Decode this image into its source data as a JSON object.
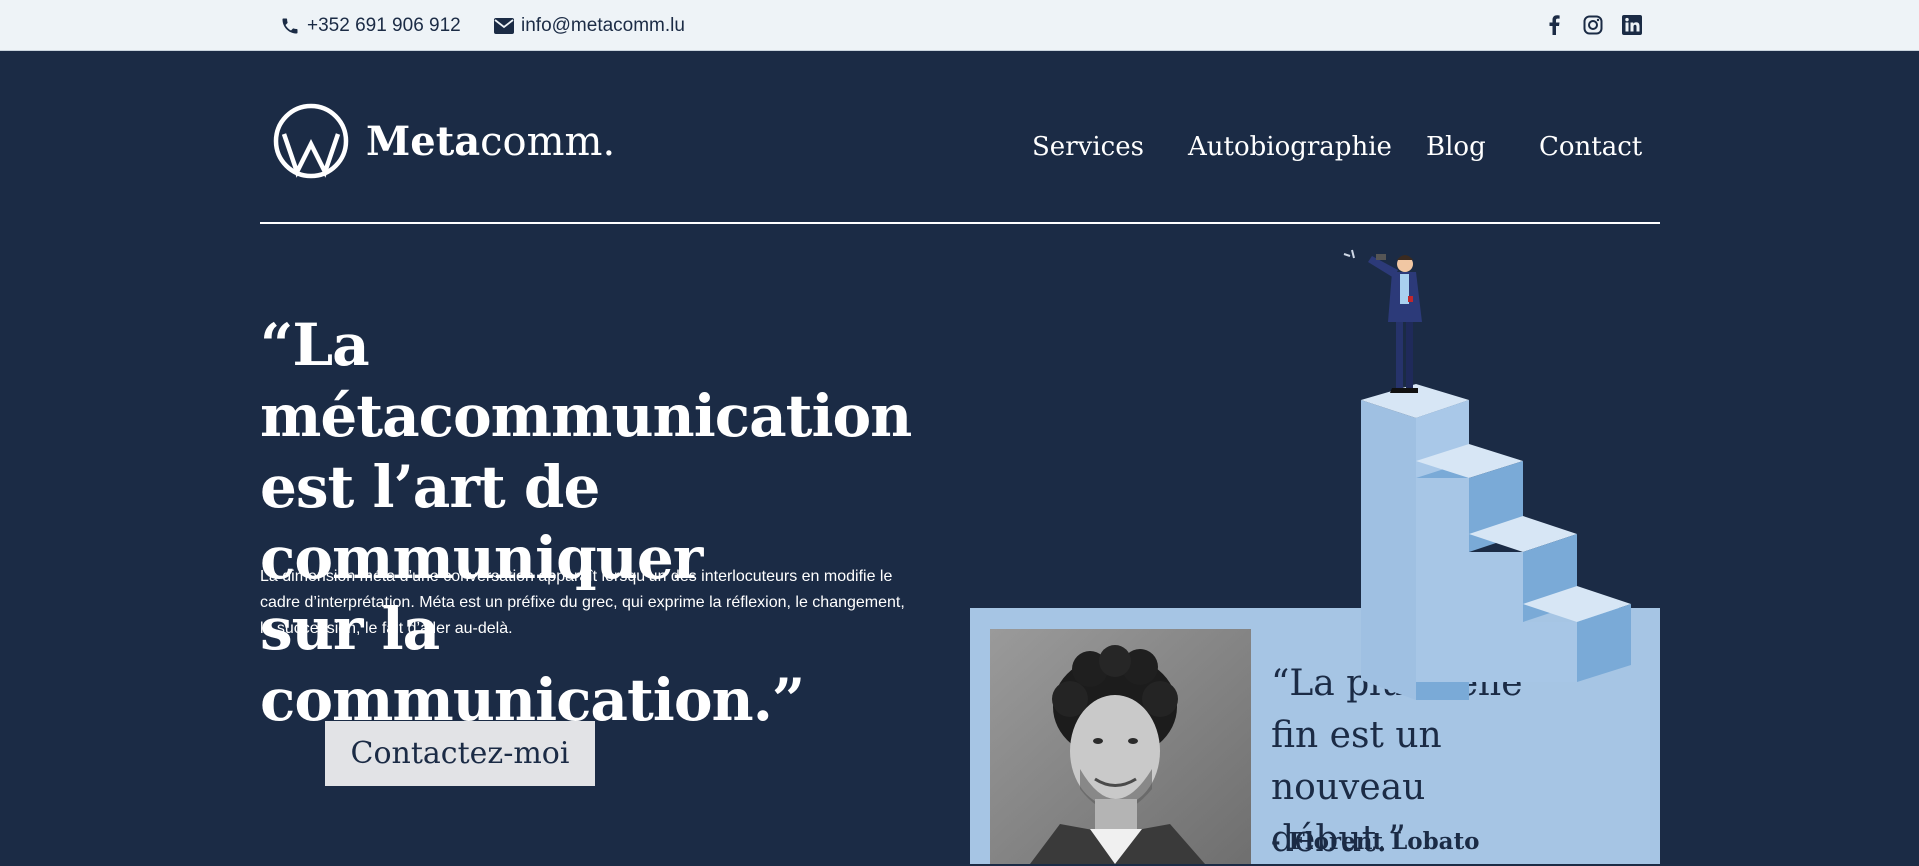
{
  "topbar": {
    "phone": "+352 691 906 912",
    "email": "info@metacomm.lu",
    "icons": [
      "phone-icon",
      "mail-icon",
      "facebook-icon",
      "instagram-icon",
      "linkedin-icon"
    ]
  },
  "logo": {
    "bold": "Meta",
    "light": "comm."
  },
  "nav": {
    "services": "Services",
    "autobiographie": "Autobiographie",
    "blog": "Blog",
    "contact": "Contact"
  },
  "hero": {
    "line1": "“La métacommunication",
    "line2": "est l’art de communiquer",
    "line3": "sur la communication.”",
    "description": "La dimension méta d’une conversation apparaît lorsqu’un des interlocuteurs en modifie le cadre d’interprétation. Méta est un préfixe du grec, qui exprime la réflexion, le changement, la succession, le fait d’aller au-delà.",
    "cta": "Contactez-moi"
  },
  "quote": {
    "text": "“La plus belle fin est un nouveau début.”",
    "author": "- Florent Lobato"
  },
  "colors": {
    "background": "#1b2b45",
    "topbar": "#eef3f7",
    "panel": "#a6c5e4",
    "stairs_light": "#a7c6e6",
    "stairs_dark": "#7aaad7"
  }
}
